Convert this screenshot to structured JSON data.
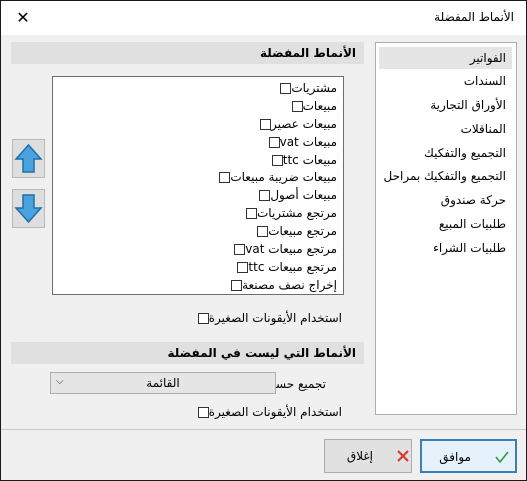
{
  "window": {
    "title": "الأنماط المفضلة",
    "close_glyph": "✕"
  },
  "categories": [
    "الفواتير",
    "السندات",
    "الأوراق التجارية",
    "المناقلات",
    "التجميع والتفكيك",
    "التجميع والتفكيك بمراحل",
    "حركة صندوق",
    "طلبيات المبيع",
    "طلبيات الشراء"
  ],
  "selected_category": "الفواتير",
  "favorites": {
    "header": "الأنماط المفضلة",
    "items": [
      "مشتريات",
      "مبيعات",
      "مبيعات عصير",
      "مبيعات vat",
      "مبيعات ttc",
      "مبيعات ضريبة مبيعات",
      "مبيعات أصول",
      "مرتجع مشتريات",
      "مرتجع مبيعات",
      "مرتجع مبيعات vat",
      "مرتجع مبيعات ttc",
      "إخراج نصف مصنعة"
    ],
    "small_icons_label": "استخدام الأيقونات الصغيرة",
    "small_icons_checked": false
  },
  "non_favorites": {
    "header": "الأنماط التي ليست في المفضلة",
    "group_by_label": "تجميع حسب",
    "group_by_value": "القائمة",
    "small_icons_label": "استخدام الأيقونات الصغيرة",
    "small_icons_checked": false
  },
  "buttons": {
    "ok": "موافق",
    "close": "إغلاق"
  },
  "icons": {
    "up": "arrow-up-icon",
    "down": "arrow-down-icon",
    "ok": "checkmark-icon",
    "close": "red-x-icon"
  },
  "colors": {
    "arrow_fill": "#4aa3df",
    "arrow_stroke": "#1f6fa8",
    "ok_check": "#2e9c3a",
    "close_x": "#d9362b",
    "primary_border": "#3c7fb1"
  }
}
